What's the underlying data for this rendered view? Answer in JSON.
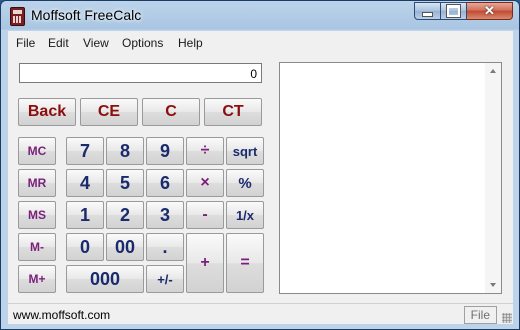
{
  "window": {
    "title": "Moffsoft FreeCalc"
  },
  "menu": [
    "File",
    "Edit",
    "View",
    "Options",
    "Help"
  ],
  "display": {
    "value": "0"
  },
  "top_buttons": [
    "Back",
    "CE",
    "C",
    "CT"
  ],
  "memory_buttons": [
    "MC",
    "MR",
    "MS",
    "M-",
    "M+"
  ],
  "digits": {
    "d7": "7",
    "d8": "8",
    "d9": "9",
    "d4": "4",
    "d5": "5",
    "d6": "6",
    "d1": "1",
    "d2": "2",
    "d3": "3",
    "d0": "0",
    "d00": "00",
    "dot": ".",
    "d000": "000",
    "plusminus": "+/-"
  },
  "operators": {
    "divide": "÷",
    "multiply": "×",
    "subtract": "-",
    "add": "+",
    "equals": "="
  },
  "functions": {
    "sqrt": "sqrt",
    "percent": "%",
    "reciprocal": "1/x"
  },
  "status": {
    "url": "www.moffsoft.com",
    "file": "File"
  },
  "colors": {
    "top_label": "#8b0e0e",
    "memory_label": "#7a1f7a",
    "digit_label": "#1a2a6c",
    "operator_label": "#7a1f7a"
  }
}
